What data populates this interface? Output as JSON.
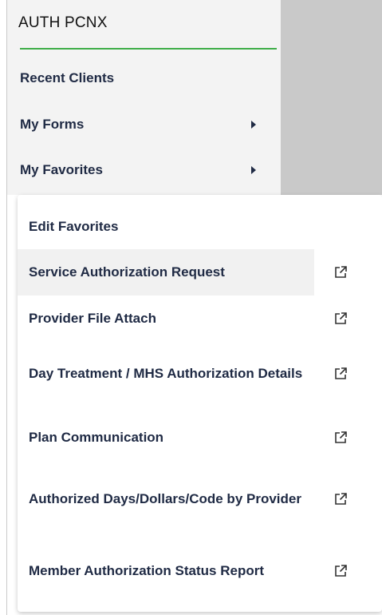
{
  "nav": {
    "title": "AUTH PCNX",
    "items": [
      {
        "label": "Recent Clients",
        "has_submenu": false
      },
      {
        "label": "My Forms",
        "has_submenu": true
      },
      {
        "label": "My Favorites",
        "has_submenu": true
      }
    ]
  },
  "favorites": {
    "edit_label": "Edit Favorites",
    "items": [
      {
        "label": "Service Authorization Request",
        "icon": "external-link-icon",
        "highlighted": true
      },
      {
        "label": "Provider File Attach",
        "icon": "external-link-icon",
        "highlighted": false
      },
      {
        "label": "Day Treatment / MHS Authorization Details",
        "icon": "external-link-icon",
        "highlighted": false
      },
      {
        "label": "Plan Communication",
        "icon": "external-link-icon",
        "highlighted": false
      },
      {
        "label": "Authorized Days/Dollars/Code by Provider",
        "icon": "external-link-icon",
        "highlighted": false
      },
      {
        "label": "Member Authorization Status Report",
        "icon": "external-link-icon",
        "highlighted": false
      }
    ]
  },
  "colors": {
    "accent_rule": "#3fae49",
    "text": "#1f2a44",
    "panel_bg": "#f3f3f3",
    "app_bg": "#c9c9c9"
  }
}
